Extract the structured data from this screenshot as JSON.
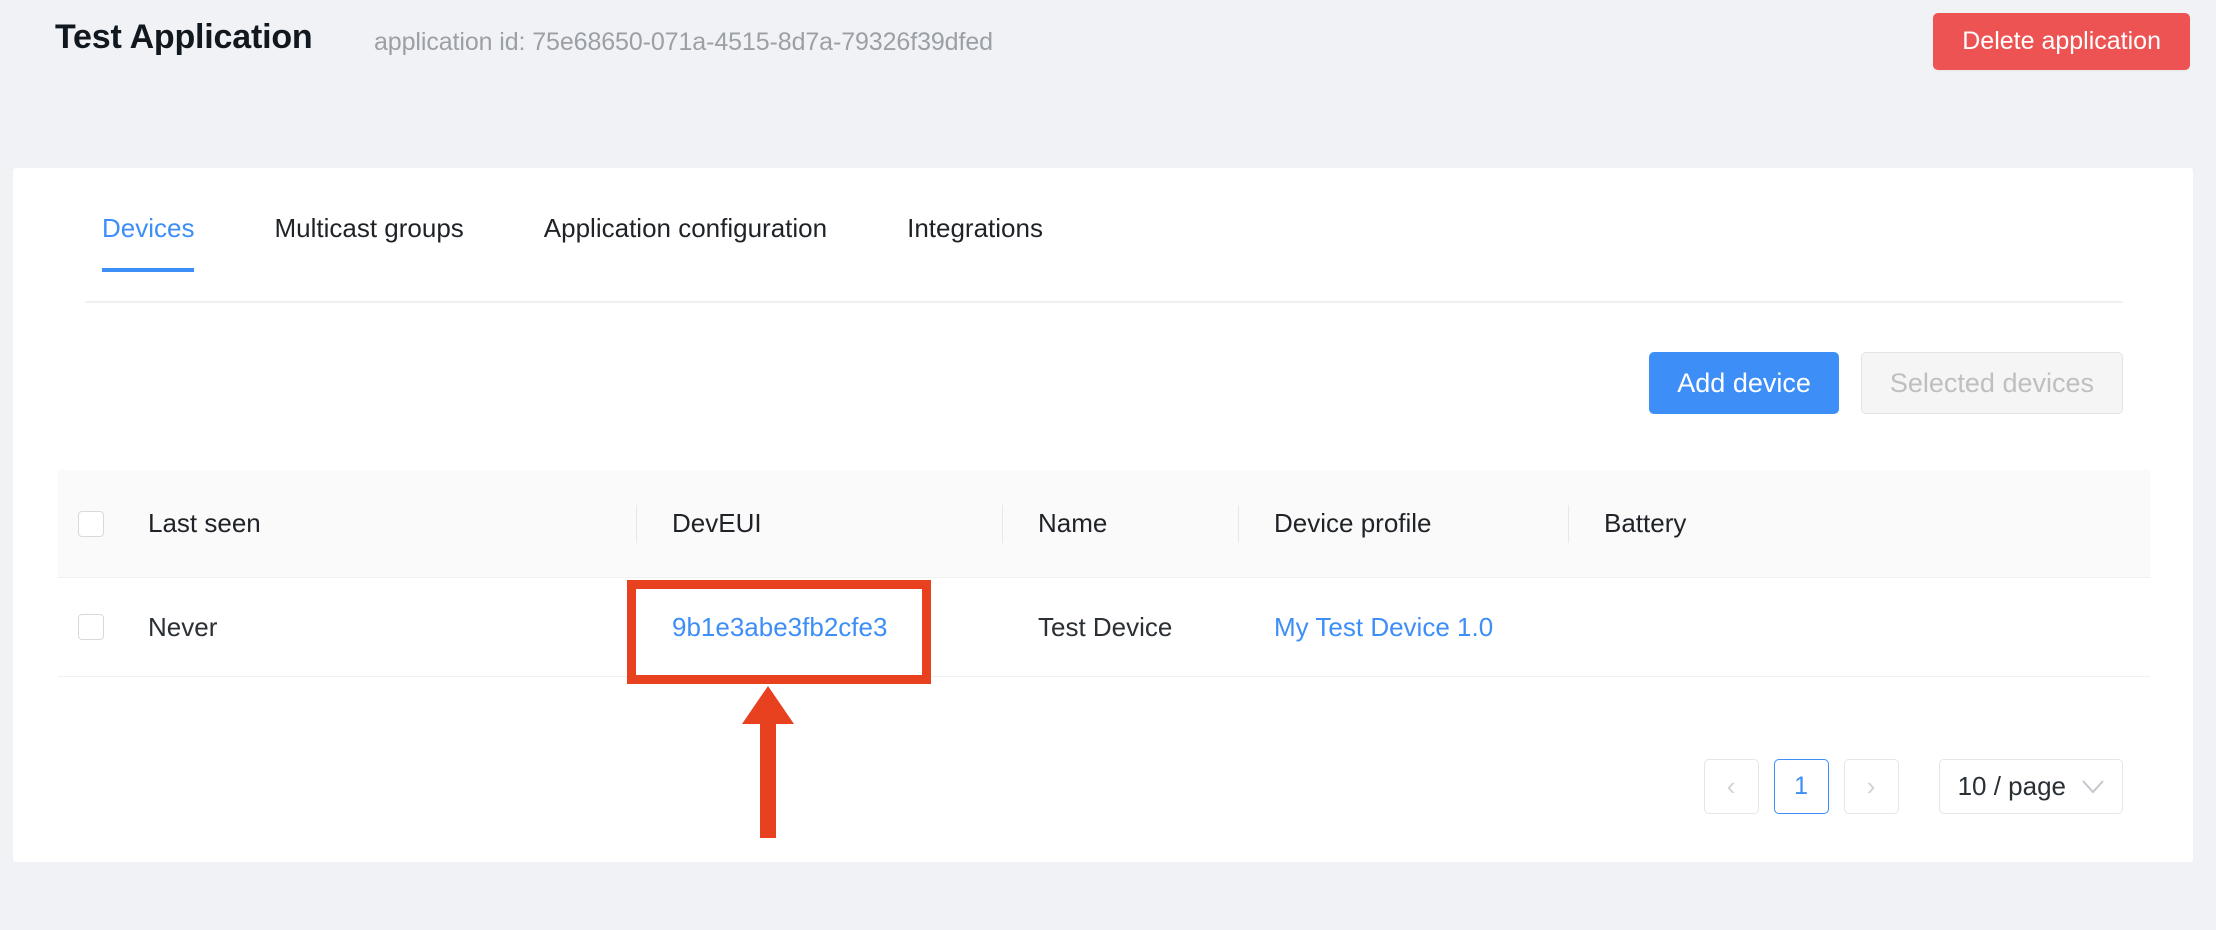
{
  "header": {
    "title": "Test Application",
    "application_id_label": "application id: 75e68650-071a-4515-8d7a-79326f39dfed",
    "delete_button": "Delete application"
  },
  "tabs": [
    {
      "label": "Devices",
      "active": true
    },
    {
      "label": "Multicast groups",
      "active": false
    },
    {
      "label": "Application configuration",
      "active": false
    },
    {
      "label": "Integrations",
      "active": false
    }
  ],
  "toolbar": {
    "add_device_label": "Add device",
    "selected_devices_label": "Selected devices"
  },
  "table": {
    "columns": [
      "Last seen",
      "DevEUI",
      "Name",
      "Device profile",
      "Battery"
    ],
    "rows": [
      {
        "last_seen": "Never",
        "deveui": "9b1e3abe3fb2cfe3",
        "name": "Test Device",
        "device_profile": "My Test Device 1.0",
        "battery": ""
      }
    ]
  },
  "pagination": {
    "prev": "‹",
    "pages": [
      "1"
    ],
    "current_page": "1",
    "next": "›",
    "page_size": "10 / page",
    "chevron_icon": "chevron-down-icon"
  },
  "annotations": {
    "highlight_target": "9b1e3abe3fb2cfe3",
    "color": "#e8411f"
  },
  "colors": {
    "page_background": "#f0f2f5",
    "card_background": "#ffffff",
    "primary": "#3e8ef7",
    "danger": "#ee5353",
    "annotation_red": "#e8411f",
    "header_row": "#fafafa"
  }
}
